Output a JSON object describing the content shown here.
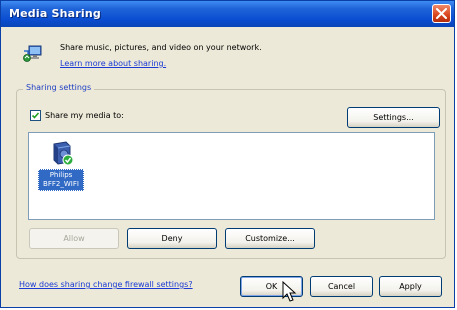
{
  "window": {
    "title": "Media Sharing"
  },
  "header": {
    "description": "Share music, pictures, and video on your network.",
    "learn_more_link": "Learn more about sharing."
  },
  "sharing_settings": {
    "group_label": "Sharing settings",
    "share_checkbox_label": "Share my media to:",
    "share_checked": true,
    "settings_button": "Settings..."
  },
  "devices": [
    {
      "label_line1": "Philips",
      "label_line2": "BFF2_WIFI",
      "selected": true
    }
  ],
  "device_actions": {
    "allow_button": "Allow",
    "deny_button": "Deny",
    "customize_button": "Customize..."
  },
  "footer": {
    "firewall_link": "How does sharing change firewall settings?",
    "ok_button": "OK",
    "cancel_button": "Cancel",
    "apply_button": "Apply"
  },
  "colors": {
    "titlebar": "#0b4ed2",
    "dialog_bg": "#ece9d8",
    "link": "#1a3ad3",
    "selection": "#316ac5",
    "close_button": "#d9441c"
  }
}
